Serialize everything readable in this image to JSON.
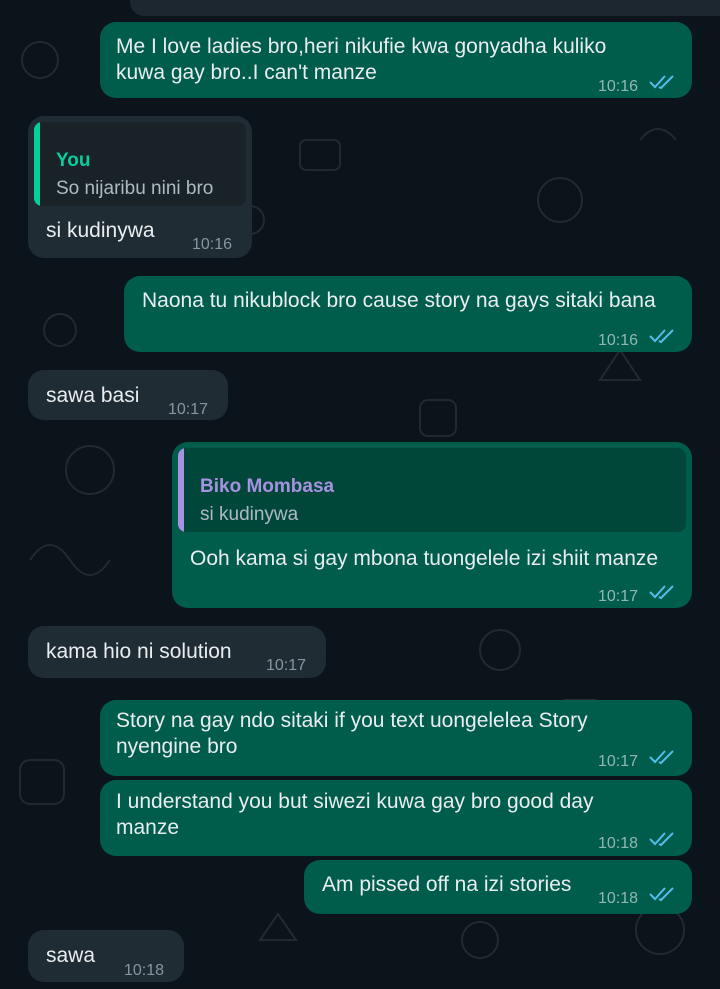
{
  "colors": {
    "background": "#0b141a",
    "outgoing_bubble": "#005c4b",
    "incoming_bubble": "#202c33",
    "read_ticks": "#53bdeb",
    "quote_you": "#06cf9c",
    "quote_contact": "#a791e0"
  },
  "messages": [
    {
      "id": "m1",
      "direction": "outgoing",
      "lines": [
        "Me I love ladies bro,heri nikufie kwa gonyadha kuliko",
        "kuwa gay bro..I can't manze"
      ],
      "time": "10:16",
      "status": "read-double-tick-icon"
    },
    {
      "id": "m2",
      "direction": "incoming",
      "reply_to": {
        "name": "You",
        "text": "So nijaribu nini bro"
      },
      "lines": [
        "si kudinywa"
      ],
      "time": "10:16"
    },
    {
      "id": "m3",
      "direction": "outgoing",
      "lines": [
        "Naona tu nikublock bro cause story na gays sitaki bana"
      ],
      "time": "10:16",
      "status": "read-double-tick-icon"
    },
    {
      "id": "m4",
      "direction": "incoming",
      "lines": [
        "sawa basi"
      ],
      "time": "10:17"
    },
    {
      "id": "m5",
      "direction": "outgoing",
      "reply_to": {
        "name": "Biko Mombasa",
        "text": "si kudinywa"
      },
      "lines": [
        "Ooh kama si gay mbona tuongelele izi shiit manze"
      ],
      "time": "10:17",
      "status": "read-double-tick-icon"
    },
    {
      "id": "m6",
      "direction": "incoming",
      "lines": [
        "kama hio ni solution"
      ],
      "time": "10:17"
    },
    {
      "id": "m7",
      "direction": "outgoing",
      "lines": [
        "Story na gay ndo sitaki if you text uongelelea Story",
        "nyengine bro"
      ],
      "time": "10:17",
      "status": "read-double-tick-icon"
    },
    {
      "id": "m8",
      "direction": "outgoing",
      "lines": [
        "I understand you but siwezi kuwa gay bro good day",
        "manze"
      ],
      "time": "10:18",
      "status": "read-double-tick-icon"
    },
    {
      "id": "m9",
      "direction": "outgoing",
      "lines": [
        "Am pissed off na izi stories"
      ],
      "time": "10:18",
      "status": "read-double-tick-icon"
    },
    {
      "id": "m10",
      "direction": "incoming",
      "lines": [
        "sawa"
      ],
      "time": "10:18"
    }
  ]
}
